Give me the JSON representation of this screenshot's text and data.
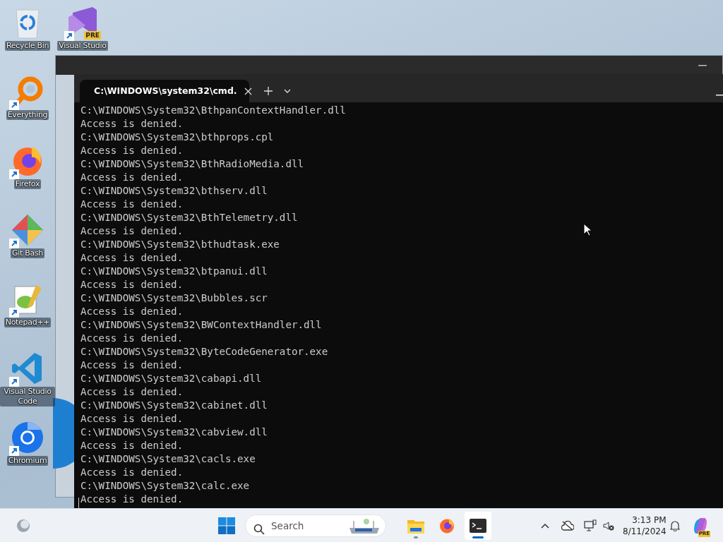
{
  "desktop_icons": [
    {
      "label": "Recycle Bin",
      "kind": "recycle",
      "shortcut": false
    },
    {
      "label": "Visual Studio",
      "kind": "vs",
      "shortcut": true,
      "badge": "PRE"
    },
    {
      "label": "Everything",
      "kind": "everything",
      "shortcut": true
    },
    {
      "label": "Firefox",
      "kind": "firefox",
      "shortcut": true
    },
    {
      "label": "Git Bash",
      "kind": "git",
      "shortcut": true
    },
    {
      "label": "Notepad++",
      "kind": "notepad",
      "shortcut": true
    },
    {
      "label": "Visual Studio Code",
      "kind": "vscode",
      "shortcut": true
    },
    {
      "label": "Chromium",
      "kind": "chromium",
      "shortcut": true
    }
  ],
  "terminal": {
    "tab": {
      "title": "C:\\WINDOWS\\system32\\cmd."
    },
    "lines": [
      "C:\\WINDOWS\\System32\\BthpanContextHandler.dll",
      "Access is denied.",
      "C:\\WINDOWS\\System32\\bthprops.cpl",
      "Access is denied.",
      "C:\\WINDOWS\\System32\\BthRadioMedia.dll",
      "Access is denied.",
      "C:\\WINDOWS\\System32\\bthserv.dll",
      "Access is denied.",
      "C:\\WINDOWS\\System32\\BthTelemetry.dll",
      "Access is denied.",
      "C:\\WINDOWS\\System32\\bthudtask.exe",
      "Access is denied.",
      "C:\\WINDOWS\\System32\\btpanui.dll",
      "Access is denied.",
      "C:\\WINDOWS\\System32\\Bubbles.scr",
      "Access is denied.",
      "C:\\WINDOWS\\System32\\BWContextHandler.dll",
      "Access is denied.",
      "C:\\WINDOWS\\System32\\ByteCodeGenerator.exe",
      "Access is denied.",
      "C:\\WINDOWS\\System32\\cabapi.dll",
      "Access is denied.",
      "C:\\WINDOWS\\System32\\cabinet.dll",
      "Access is denied.",
      "C:\\WINDOWS\\System32\\cabview.dll",
      "Access is denied.",
      "C:\\WINDOWS\\System32\\cacls.exe",
      "Access is denied.",
      "C:\\WINDOWS\\System32\\calc.exe",
      "Access is denied."
    ]
  },
  "taskbar": {
    "search": {
      "placeholder": "Search"
    },
    "apps": [
      {
        "kind": "explorer",
        "open": true,
        "selected": false
      },
      {
        "kind": "firefox",
        "open": false,
        "selected": false
      },
      {
        "kind": "terminal",
        "open": true,
        "selected": true
      }
    ],
    "clock": {
      "time": "3:13 PM",
      "date": "8/11/2024"
    },
    "copilot": {
      "badge": "PRE"
    }
  }
}
